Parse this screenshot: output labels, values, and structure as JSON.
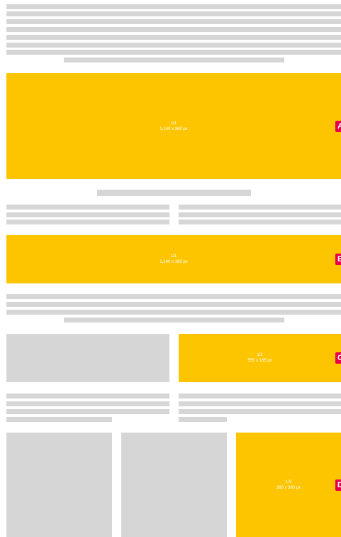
{
  "colors": {
    "placeholder": "#d6d6d6",
    "ad_slot": "#fdc500",
    "badge": "#e6004c"
  },
  "slots": {
    "a": {
      "ratio": "1/1",
      "size": "1,140 x 360 px",
      "badge": "A"
    },
    "b": {
      "ratio": "1/1",
      "size": "1,140 x 165 px",
      "badge": "B"
    },
    "c": {
      "ratio": "1/2",
      "size": "555 x 165 px",
      "badge": "C"
    },
    "d": {
      "ratio": "1/3",
      "size": "360 x 360 px",
      "badge": "D"
    }
  }
}
